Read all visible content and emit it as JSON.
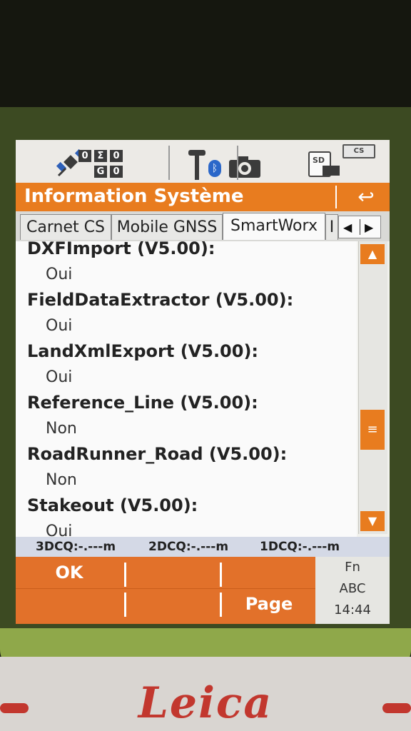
{
  "device": {
    "brand_logo": "Leica"
  },
  "status_bar": {
    "sat_boxes": [
      "0",
      "Σ",
      "0",
      "G",
      "0"
    ],
    "bluetooth_icon": "bluetooth-icon",
    "camera_icon": "camera-icon",
    "sd_label": "SD",
    "battery_label": "CS"
  },
  "title": {
    "text": "Information Système",
    "back_icon": "↩"
  },
  "tabs": [
    "Carnet CS",
    "Mobile GNSS",
    "SmartWorx",
    "I"
  ],
  "tab_arrows": {
    "left": "◀",
    "right": "▶"
  },
  "items": [
    {
      "name": "DXFImport (V5.00):",
      "value": "Oui"
    },
    {
      "name": "FieldDataExtractor (V5.00):",
      "value": "Oui"
    },
    {
      "name": "LandXmlExport (V5.00):",
      "value": "Oui"
    },
    {
      "name": "Reference_Line (V5.00):",
      "value": "Non"
    },
    {
      "name": "RoadRunner_Road (V5.00):",
      "value": "Non"
    },
    {
      "name": "Stakeout (V5.00):",
      "value": "Oui"
    }
  ],
  "scroll": {
    "up": "▲",
    "down": "▼",
    "thumb": "≡"
  },
  "quality": [
    "3DCQ:-.---m",
    "2DCQ:-.---m",
    "1DCQ:-.---m"
  ],
  "softkeys": {
    "ok": "OK",
    "page": "Page"
  },
  "side_panel": {
    "fn": "Fn",
    "mode": "ABC",
    "time": "14:44"
  }
}
